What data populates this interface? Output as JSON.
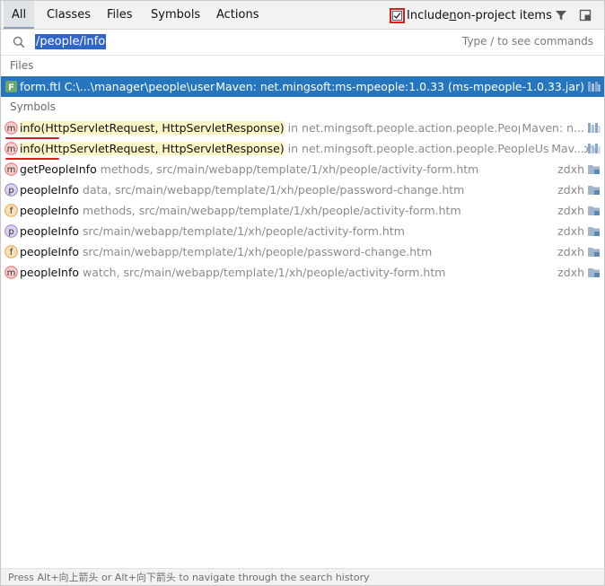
{
  "tabs": [
    {
      "label": "All",
      "active": true
    },
    {
      "label": "Classes",
      "active": false
    },
    {
      "label": "Files",
      "active": false
    },
    {
      "label": "Symbols",
      "active": false
    },
    {
      "label": "Actions",
      "active": false
    }
  ],
  "include": {
    "checked": true,
    "pre": "Include ",
    "underline": "n",
    "post": "on-project items"
  },
  "search": {
    "value": "/people/info",
    "hint": "Type / to see commands"
  },
  "sections": {
    "files": "Files",
    "symbols": "Symbols"
  },
  "files": [
    {
      "icon": "freemarker-file-icon",
      "name": "form.ftl",
      "path": "C:\\...\\manager\\people\\user",
      "location": "Maven: net.mingsoft:ms-mpeople:1.0.33 (ms-mpeople-1.0.33.jar)",
      "selected": true
    }
  ],
  "symbols": [
    {
      "kind": "m",
      "name": "info(HttpServletRequest, HttpServletResponse)",
      "detail": "in net.mingsoft.people.action.people.PeopleAction",
      "location": "Maven: n...",
      "highlighted": true
    },
    {
      "kind": "m",
      "name": "info(HttpServletRequest, HttpServletResponse)",
      "detail": "in net.mingsoft.people.action.people.PeopleUserAction",
      "location": "Mav...",
      "highlighted": true
    },
    {
      "kind": "m",
      "name": "getPeopleInfo",
      "detail": "methods, src/main/webapp/template/1/xh/people/activity-form.htm",
      "location": "zdxh"
    },
    {
      "kind": "p",
      "name": "peopleInfo",
      "detail": "data, src/main/webapp/template/1/xh/people/password-change.htm",
      "location": "zdxh"
    },
    {
      "kind": "f",
      "name": "peopleInfo",
      "detail": "methods, src/main/webapp/template/1/xh/people/activity-form.htm",
      "location": "zdxh"
    },
    {
      "kind": "p",
      "name": "peopleInfo",
      "detail": "src/main/webapp/template/1/xh/people/activity-form.htm",
      "location": "zdxh"
    },
    {
      "kind": "f",
      "name": "peopleInfo",
      "detail": "src/main/webapp/template/1/xh/people/password-change.htm",
      "location": "zdxh"
    },
    {
      "kind": "m",
      "name": "peopleInfo",
      "detail": "watch, src/main/webapp/template/1/xh/people/activity-form.htm",
      "location": "zdxh"
    }
  ],
  "kind_colors": {
    "m": "#e8716f",
    "p": "#9b7fd1",
    "f": "#e8a23c"
  },
  "status": "Press Alt+向上箭头 or Alt+向下箭头 to navigate through the search history"
}
